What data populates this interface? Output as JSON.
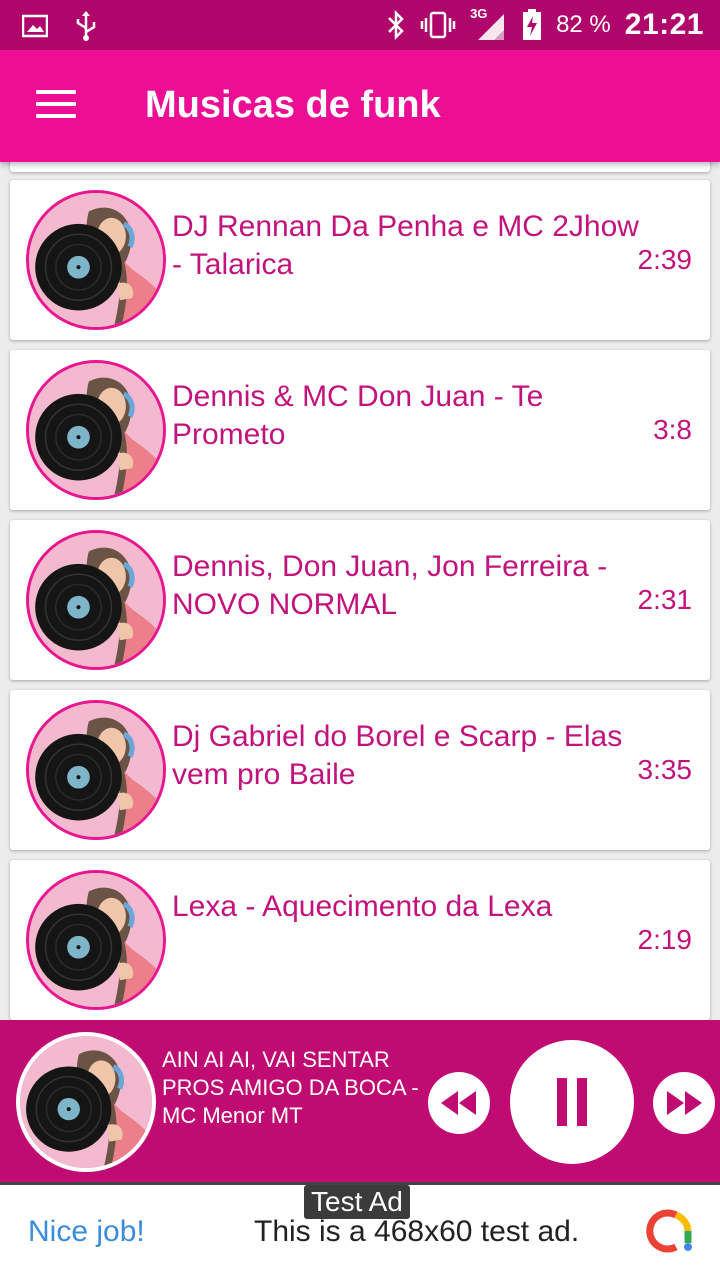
{
  "status_bar": {
    "battery_percent": "82 %",
    "time": "21:21",
    "network": "3G",
    "icons": [
      "image-icon",
      "usb-icon",
      "bluetooth-icon",
      "vibrate-icon",
      "signal-icon",
      "battery-charging-icon"
    ]
  },
  "toolbar": {
    "title": "Musicas de funk",
    "menu_icon": "hamburger-menu-icon"
  },
  "songs": [
    {
      "title": "DJ Rennan Da Penha e MC 2Jhow - Talarica",
      "duration": "2:39"
    },
    {
      "title": "Dennis & MC Don Juan - Te Prometo",
      "duration": "3:8"
    },
    {
      "title": "Dennis, Don Juan, Jon Ferreira - NOVO NORMAL",
      "duration": "2:31"
    },
    {
      "title": "Dj Gabriel do Borel e Scarp - Elas vem pro Baile",
      "duration": "3:35"
    },
    {
      "title": "Lexa - Aquecimento da Lexa",
      "duration": "2:19"
    }
  ],
  "player": {
    "now_playing": "AIN AI AI, VAI SENTAR PROS AMIGO DA BOCA - MC Menor MT",
    "controls": [
      "rewind-icon",
      "pause-icon",
      "fast-forward-icon"
    ]
  },
  "ad": {
    "label": "Test Ad",
    "nice": "Nice job!",
    "text": "This is a 468x60 test ad."
  },
  "colors": {
    "status_bar": "#b0066b",
    "toolbar": "#ec0e94",
    "accent_text": "#c2137c",
    "player_bar": "#c00b73"
  }
}
